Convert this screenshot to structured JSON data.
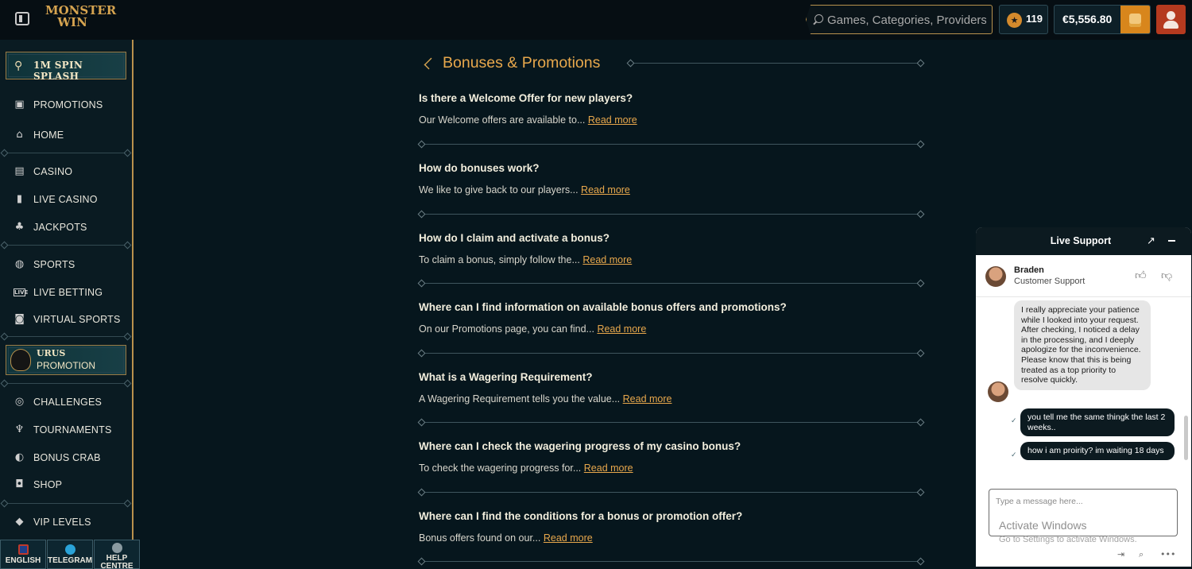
{
  "header": {
    "logo_top": "MONSTER",
    "logo_bottom": "WIN",
    "search_placeholder": "Games, Categories, Providers",
    "points": "119",
    "balance": "€5,556.80"
  },
  "sidebar": {
    "banner_spin": "1M SPIN SPLASH",
    "items_top": [
      {
        "label": "PROMOTIONS",
        "icon": "gift-icon"
      },
      {
        "label": "HOME",
        "icon": "home-icon"
      }
    ],
    "items_casino": [
      {
        "label": "CASINO",
        "icon": "slot-machine-icon"
      },
      {
        "label": "LIVE CASINO",
        "icon": "cards-icon"
      },
      {
        "label": "JACKPOTS",
        "icon": "clover-icon"
      }
    ],
    "items_sports": [
      {
        "label": "SPORTS",
        "icon": "ball-icon"
      },
      {
        "label": "LIVE BETTING",
        "icon": "live-icon"
      },
      {
        "label": "VIRTUAL SPORTS",
        "icon": "virtual-icon"
      }
    ],
    "banner_urus_title": "URUS",
    "banner_urus_sub": "PROMOTION",
    "items_extra": [
      {
        "label": "CHALLENGES",
        "icon": "target-icon"
      },
      {
        "label": "TOURNAMENTS",
        "icon": "trophy-icon"
      },
      {
        "label": "BONUS CRAB",
        "icon": "crab-icon"
      },
      {
        "label": "SHOP",
        "icon": "bag-icon"
      }
    ],
    "items_vip": [
      {
        "label": "VIP LEVELS",
        "icon": "diamond-icon"
      }
    ],
    "bottom": [
      {
        "label": "ENGLISH",
        "icon": "flag-uk-icon",
        "color": "#1f3f8a"
      },
      {
        "label": "TELEGRAM",
        "icon": "telegram-icon",
        "color": "#2aa3d8"
      },
      {
        "label": "HELP CENTRE",
        "icon": "help-icon",
        "color": "#8a9aa0"
      }
    ]
  },
  "main": {
    "title": "Bonuses & Promotions",
    "read_more": "Read more",
    "faqs": [
      {
        "q": "Is there a Welcome Offer for new players?",
        "a": "Our Welcome offers are available to..."
      },
      {
        "q": "How do bonuses work?",
        "a": "We like to give back to our players..."
      },
      {
        "q": "How do I claim and activate a bonus?",
        "a": "To claim a bonus, simply follow the..."
      },
      {
        "q": "Where can I find information on available bonus offers and promotions?",
        "a": "On our Promotions page, you can find..."
      },
      {
        "q": "What is a Wagering Requirement?",
        "a": "A Wagering Requirement tells you the value..."
      },
      {
        "q": "Where can I check the wagering progress of my casino bonus?",
        "a": "To check the wagering progress for..."
      },
      {
        "q": "Where can I find the conditions for a bonus or promotion offer?",
        "a": "Bonus offers found on our..."
      }
    ]
  },
  "chat": {
    "title": "Live Support",
    "agent_name": "Braden",
    "agent_role": "Customer Support",
    "messages": [
      {
        "from": "agent",
        "text": "I really appreciate your patience while I looked into your request. After checking, I noticed a delay in the processing, and I deeply apologize for the inconvenience. Please know that this is being treated as a top priority to resolve quickly."
      },
      {
        "from": "user",
        "text": "you tell me the same thingk the last 2 weeks.."
      },
      {
        "from": "user",
        "text": "how i am proirity? im waiting 18 days"
      }
    ],
    "input_placeholder": "Type a message here...",
    "watermark_title": "Activate Windows",
    "watermark_sub": "Go to Settings to activate Windows."
  }
}
